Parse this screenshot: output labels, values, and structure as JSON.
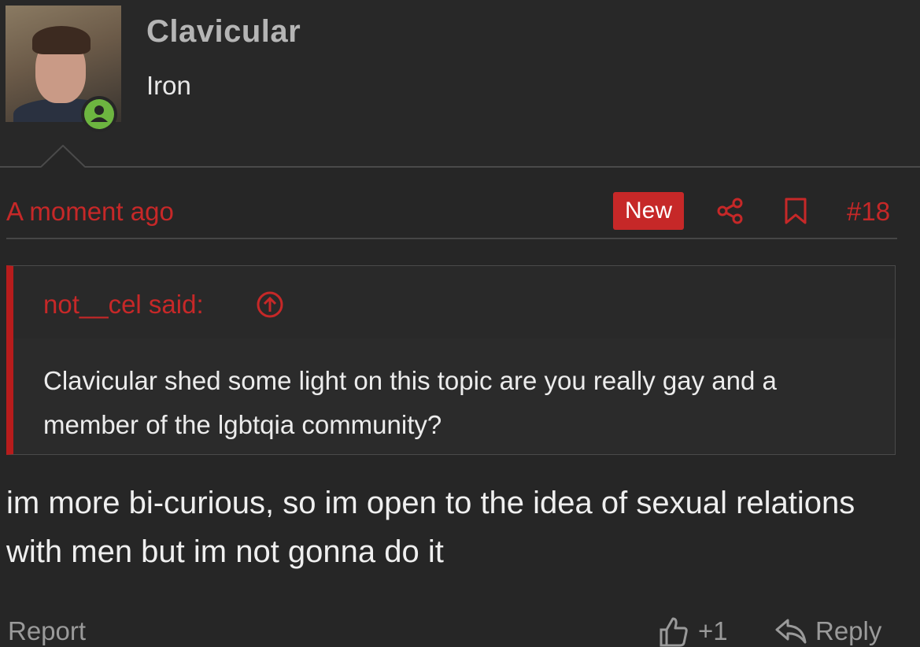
{
  "user": {
    "username": "Clavicular",
    "rank": "Iron"
  },
  "post": {
    "timestamp": "A moment ago",
    "new_badge": "New",
    "post_number": "#18",
    "quote": {
      "author_label": "not__cel said:",
      "text": "Clavicular shed some light on this topic are you really gay and a member of the lgbtqia community?"
    },
    "message": "im more bi-curious, so im open to the idea of sexual relations with men but im not gonna do it"
  },
  "footer": {
    "report_label": "Report",
    "like_count": "+1",
    "reply_label": "Reply"
  },
  "colors": {
    "accent_red": "#c62828",
    "online_green": "#6db540",
    "background": "#262626"
  },
  "icons": [
    "user-icon",
    "share-icon",
    "bookmark-icon",
    "arrow-up-circle-icon",
    "thumbs-up-icon",
    "reply-icon"
  ]
}
